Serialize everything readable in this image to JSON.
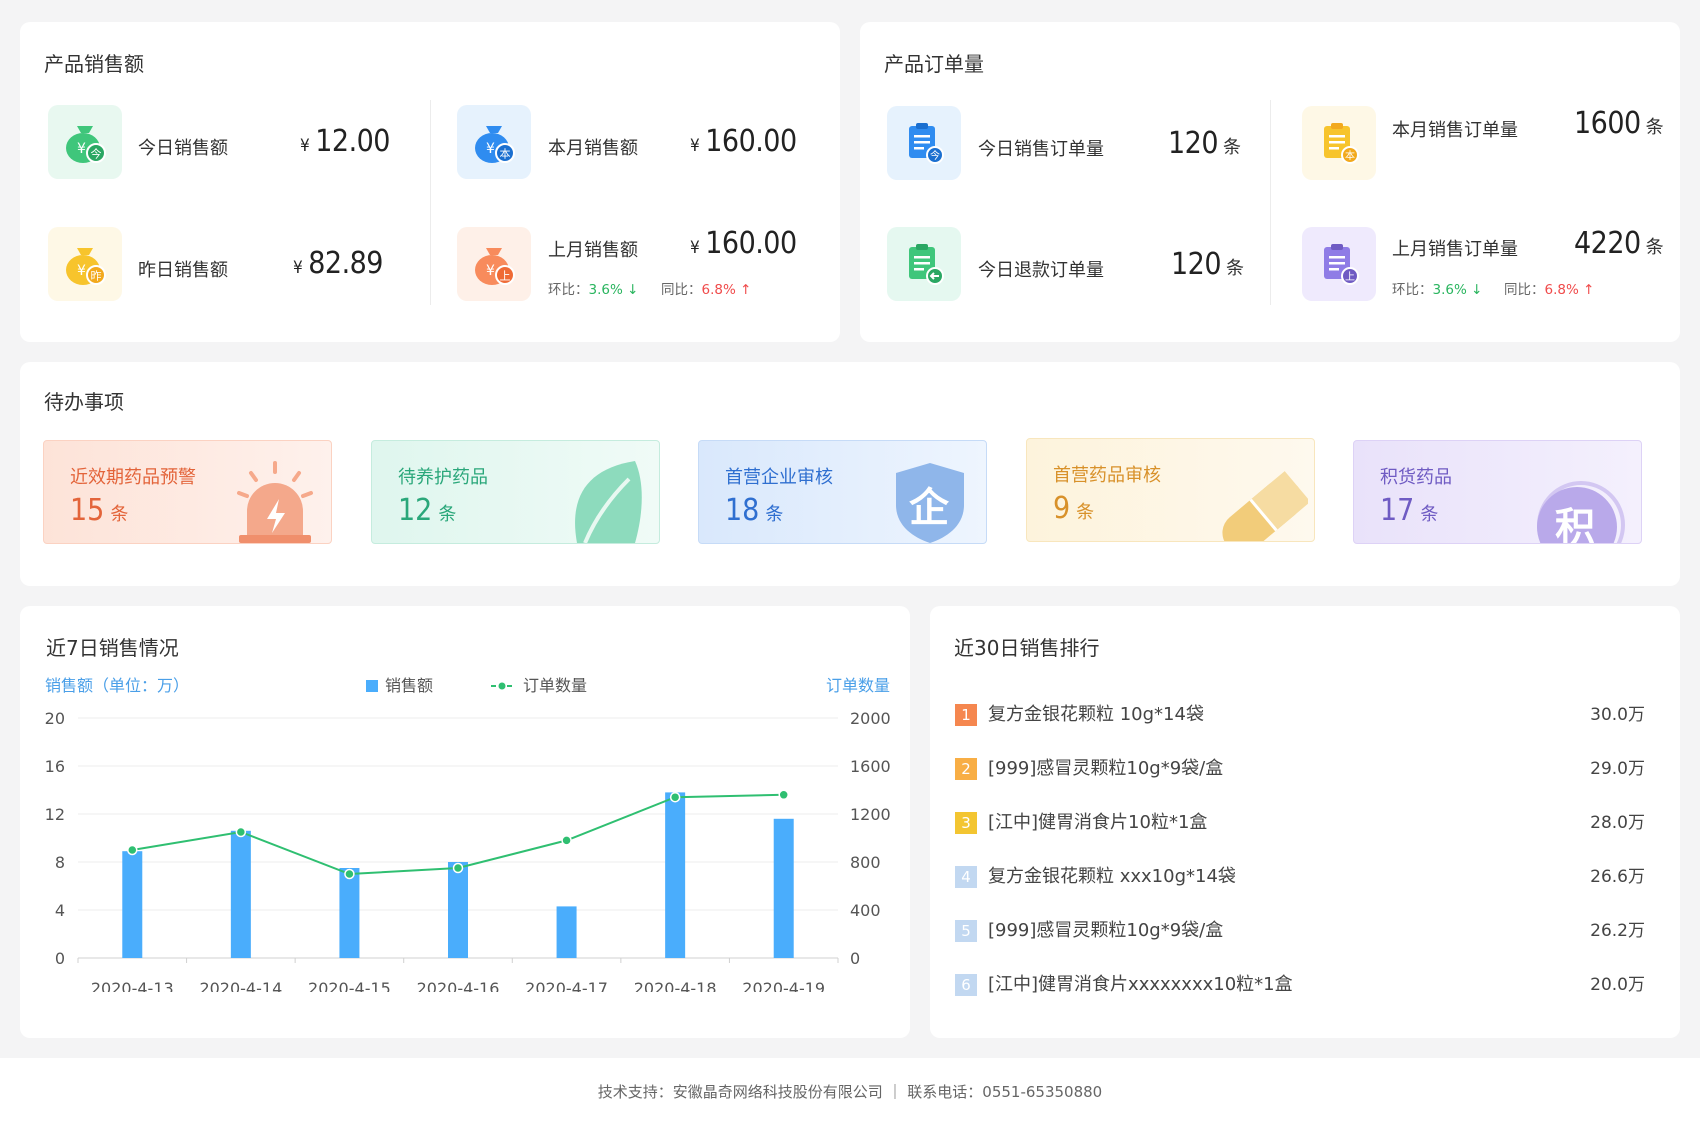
{
  "sales": {
    "title": "产品销售额",
    "today": {
      "label": "今日销售额",
      "currency": "¥",
      "value": "12.00"
    },
    "month": {
      "label": "本月销售额",
      "currency": "¥",
      "value": "160.00"
    },
    "yesterday": {
      "label": "昨日销售额",
      "currency": "¥",
      "value": "82.89"
    },
    "last_month": {
      "label": "上月销售额",
      "currency": "¥",
      "value": "160.00",
      "mom_label": "环比：",
      "mom_value": "3.6%",
      "yoy_label": "同比：",
      "yoy_value": "6.8%"
    }
  },
  "orders": {
    "title": "产品订单量",
    "today": {
      "label": "今日销售订单量",
      "value": "120",
      "unit": "条"
    },
    "month": {
      "label": "本月销售订单量",
      "value": "1600",
      "unit": "条"
    },
    "refund": {
      "label": "今日退款订单量",
      "value": "120",
      "unit": "条"
    },
    "last_month": {
      "label": "上月销售订单量",
      "value": "4220",
      "unit": "条",
      "mom_label": "环比：",
      "mom_value": "3.6%",
      "yoy_label": "同比：",
      "yoy_value": "6.8%"
    }
  },
  "icons": {
    "money_glyph": "¥",
    "today_badge": "今",
    "month_badge": "本",
    "yesterday_badge": "昨",
    "last_month_badge": "上"
  },
  "todo": {
    "title": "待办事项",
    "items": [
      {
        "name": "近效期药品预警",
        "value": "15",
        "unit": "条",
        "icon": "alarm-icon",
        "color": "#e3643a"
      },
      {
        "name": "待养护药品",
        "value": "12",
        "unit": "条",
        "icon": "leaf-icon",
        "color": "#2aa77a"
      },
      {
        "name": "首营企业审核",
        "value": "18",
        "unit": "条",
        "icon": "shield-icon",
        "glyph": "企",
        "color": "#2f6fd0"
      },
      {
        "name": "首营药品审核",
        "value": "9",
        "unit": "条",
        "icon": "pill-icon",
        "color": "#d8912a"
      },
      {
        "name": "积货药品",
        "value": "17",
        "unit": "条",
        "icon": "stock-icon",
        "glyph": "积",
        "color": "#6f5bc3"
      }
    ]
  },
  "chart": {
    "title": "近7日销售情况",
    "left_axis_label": "销售额（单位：万）",
    "right_axis_label": "订单数量",
    "legend_bar": "销售额",
    "legend_line": "订单数量"
  },
  "chart_data": {
    "type": "bar",
    "categories": [
      "2020-4-13",
      "2020-4-14",
      "2020-4-15",
      "2020-4-16",
      "2020-4-17",
      "2020-4-18",
      "2020-4-19"
    ],
    "series": [
      {
        "name": "销售额",
        "type": "bar",
        "axis": "left",
        "values": [
          8.9,
          10.6,
          7.5,
          8.0,
          4.3,
          13.8,
          11.6
        ]
      },
      {
        "name": "订单数量",
        "type": "line",
        "axis": "right",
        "values": [
          900,
          1050,
          700,
          750,
          980,
          1340,
          1360
        ]
      }
    ],
    "ylabel": "销售额（单位：万）",
    "ylabel_right": "订单数量",
    "ylim": [
      0,
      20
    ],
    "ylim_right": [
      0,
      2000
    ],
    "yticks": [
      "0",
      "4",
      "8",
      "12",
      "16",
      "20"
    ],
    "yticks_right": [
      "0",
      "400",
      "800",
      "1200",
      "1600",
      "2000"
    ],
    "grid": true,
    "legend": "top-center",
    "colors": {
      "bar": "#4aadfc",
      "line": "#2fbf71"
    }
  },
  "ranking": {
    "title": "近30日销售排行",
    "items": [
      {
        "no": "1",
        "name": "复方金银花颗粒 10g*14袋",
        "amount": "30.0万",
        "color": "#f5874f"
      },
      {
        "no": "2",
        "name": "[999]感冒灵颗粒10g*9袋/盒",
        "amount": "29.0万",
        "color": "#f8ae45"
      },
      {
        "no": "3",
        "name": "[江中]健胃消食片10粒*1盒",
        "amount": "28.0万",
        "color": "#f3c531"
      },
      {
        "no": "4",
        "name": "复方金银花颗粒 xxx10g*14袋",
        "amount": "26.6万",
        "color": "#c2d8f1"
      },
      {
        "no": "5",
        "name": "[999]感冒灵颗粒10g*9袋/盒",
        "amount": "26.2万",
        "color": "#c2d8f1"
      },
      {
        "no": "6",
        "name": "[江中]健胃消食片xxxxxxxx10粒*1盒",
        "amount": "20.0万",
        "color": "#c2d8f1"
      }
    ]
  },
  "footer": {
    "text": "技术支持：安徽晶奇网络科技股份有限公司 ｜ 联系电话：0551-65350880"
  }
}
